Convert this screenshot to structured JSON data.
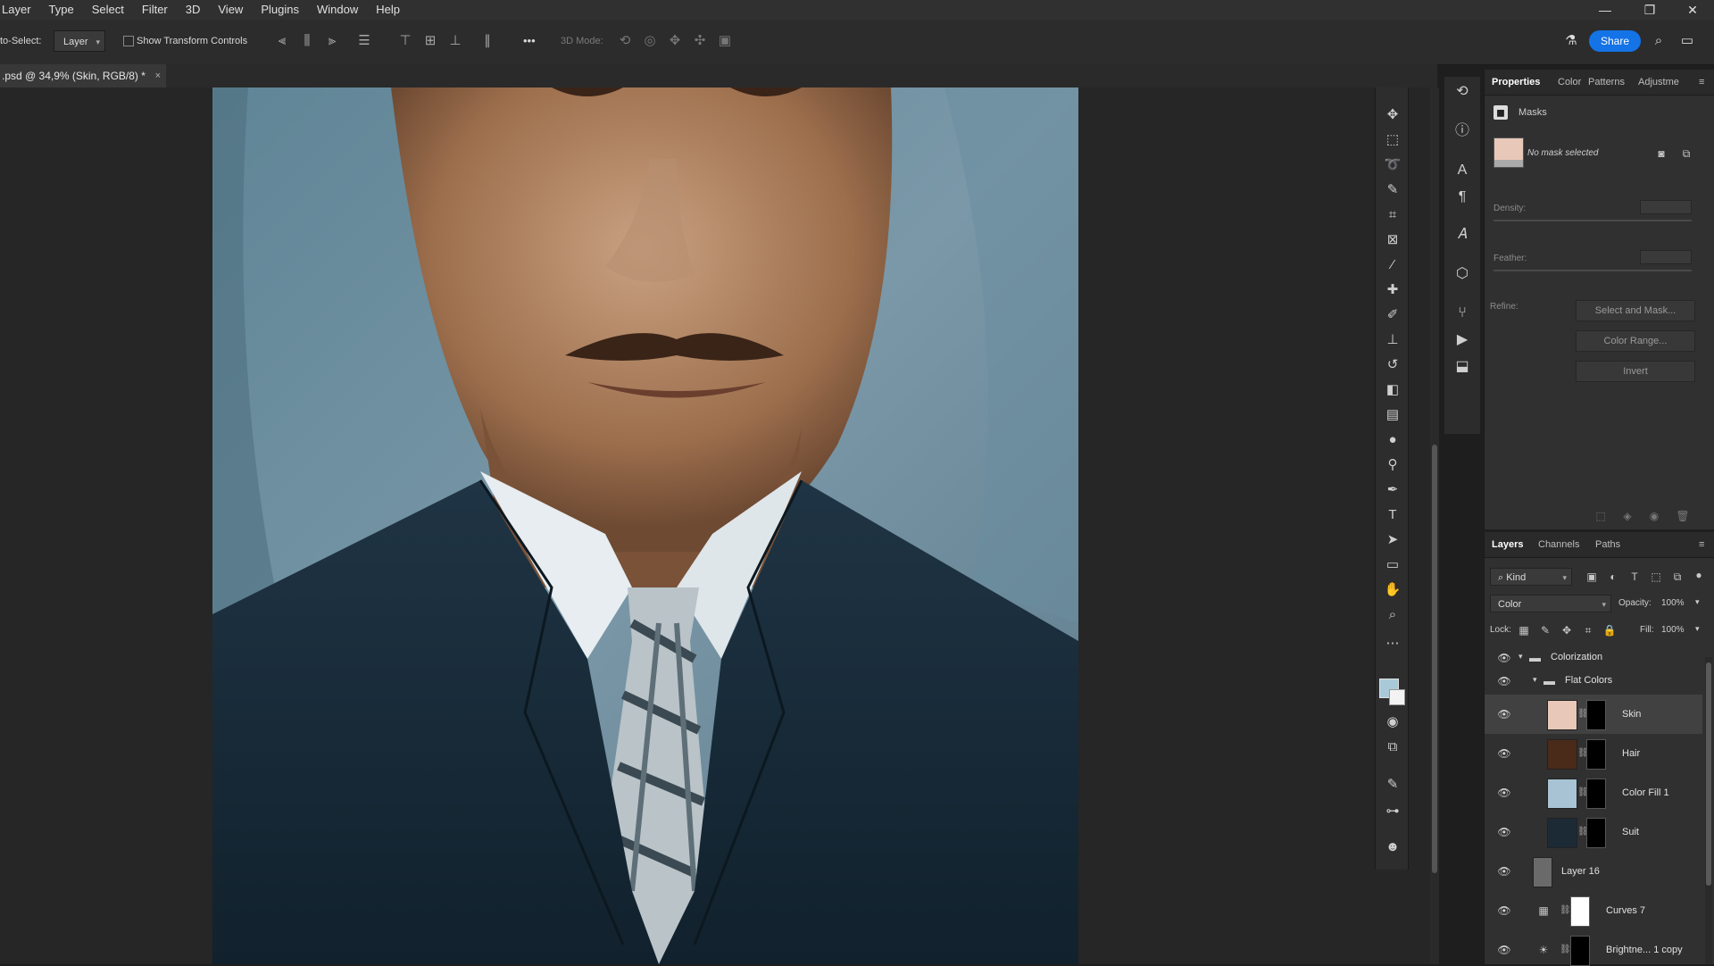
{
  "menu": [
    "Layer",
    "Type",
    "Select",
    "Filter",
    "3D",
    "View",
    "Plugins",
    "Window",
    "Help"
  ],
  "options_bar": {
    "auto_select_label": "to-Select:",
    "auto_select_value": "Layer",
    "show_transform_label": "Show Transform Controls",
    "more_label": "•••",
    "mode_3d_label": "3D Mode:",
    "share_label": "Share"
  },
  "document": {
    "tab_title": ".psd @ 34,9% (Skin, RGB/8) *",
    "close_glyph": "×"
  },
  "properties": {
    "tabs": [
      "Properties",
      "Color",
      "Patterns",
      "Adjustme"
    ],
    "section": "Masks",
    "mask_status": "No mask selected",
    "density_label": "Density:",
    "feather_label": "Feather:",
    "refine_label": "Refine:",
    "buttons": [
      "Select and Mask...",
      "Color Range...",
      "Invert"
    ]
  },
  "layers_panel": {
    "tabs": [
      "Layers",
      "Channels",
      "Paths"
    ],
    "filter_kind": "Kind",
    "blend_mode": "Color",
    "opacity_label": "Opacity:",
    "opacity_value": "100%",
    "lock_label": "Lock:",
    "fill_label": "Fill:",
    "fill_value": "100%",
    "layers": [
      {
        "name": "Colorization",
        "type": "group",
        "indent": 0,
        "selected": false
      },
      {
        "name": "Flat Colors",
        "type": "group",
        "indent": 1,
        "selected": false
      },
      {
        "name": "Skin",
        "type": "fill",
        "color": "#e8c8b8",
        "mask": "black",
        "selected": true
      },
      {
        "name": "Hair",
        "type": "fill",
        "color": "#4a2a18",
        "mask": "black",
        "selected": false
      },
      {
        "name": "Color Fill 1",
        "type": "fill",
        "color": "#a8c4d4",
        "mask": "black",
        "selected": false
      },
      {
        "name": "Suit",
        "type": "fill",
        "color": "#1c2a36",
        "mask": "black",
        "selected": false
      },
      {
        "name": "Layer 16",
        "type": "smart",
        "selected": false
      },
      {
        "name": "Curves 7",
        "type": "curves",
        "mask": "white",
        "selected": false
      },
      {
        "name": "Brightne... 1 copy",
        "type": "brightness",
        "mask": "black",
        "selected": false
      }
    ]
  },
  "colors": {
    "accent": "#1473e6",
    "foreground_swatch": "#a9c9d8",
    "background_swatch": "#f3f3f3"
  }
}
